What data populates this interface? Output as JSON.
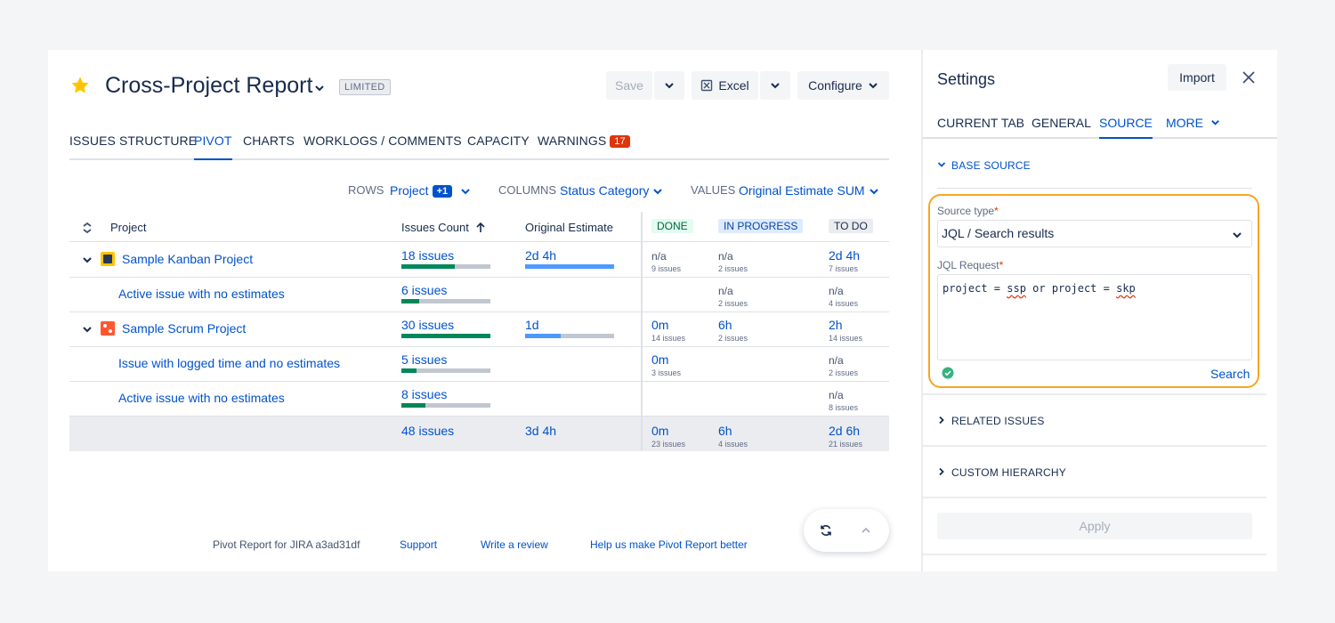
{
  "header": {
    "title": "Cross-Project Report",
    "badge": "LIMITED",
    "save_label": "Save",
    "excel_label": "Excel",
    "configure_label": "Configure"
  },
  "tabs": [
    {
      "label": "ISSUES STRUCTURE"
    },
    {
      "label": "PIVOT"
    },
    {
      "label": "CHARTS"
    },
    {
      "label": "WORKLOGS / COMMENTS"
    },
    {
      "label": "CAPACITY"
    },
    {
      "label": "WARNINGS",
      "badge": "17"
    }
  ],
  "config": {
    "rows_label": "ROWS",
    "rows_value": "Project",
    "rows_badge": "+1",
    "columns_label": "COLUMNS",
    "columns_value": "Status Category",
    "values_label": "VALUES",
    "values_value": "Original Estimate SUM"
  },
  "table": {
    "headers": {
      "project": "Project",
      "issues_count": "Issues Count",
      "original_estimate": "Original Estimate",
      "done": "DONE",
      "in_progress": "IN PROGRESS",
      "todo": "TO DO"
    },
    "rows": [
      {
        "name": "Sample Kanban Project",
        "count": "18 issues",
        "count_fill": 0.6,
        "estimate": "2d 4h",
        "est_fill": 1.0,
        "done": "n/a",
        "done_sub": "9 issues",
        "inprog": "n/a",
        "inprog_sub": "2 issues",
        "todo": "2d 4h",
        "todo_sub": "7 issues"
      },
      {
        "name": "Active issue with no estimates",
        "count": "6 issues",
        "count_fill": 0.2,
        "estimate": "",
        "est_fill": 0,
        "done": "",
        "done_sub": "",
        "inprog": "n/a",
        "inprog_sub": "2 issues",
        "todo": "n/a",
        "todo_sub": "4 issues"
      },
      {
        "name": "Sample Scrum Project",
        "count": "30 issues",
        "count_fill": 1.0,
        "estimate": "1d",
        "est_fill": 0.4,
        "done": "0m",
        "done_sub": "14 issues",
        "inprog": "6h",
        "inprog_sub": "2 issues",
        "todo": "2h",
        "todo_sub": "14 issues"
      },
      {
        "name": "Issue with logged time and no estimates",
        "count": "5 issues",
        "count_fill": 0.17,
        "estimate": "",
        "est_fill": 0,
        "done": "0m",
        "done_sub": "3 issues",
        "inprog": "",
        "inprog_sub": "",
        "todo": "n/a",
        "todo_sub": "2 issues"
      },
      {
        "name": "Active issue with no estimates",
        "count": "8 issues",
        "count_fill": 0.27,
        "estimate": "",
        "est_fill": 0,
        "done": "",
        "done_sub": "",
        "inprog": "",
        "inprog_sub": "",
        "todo": "n/a",
        "todo_sub": "8 issues"
      }
    ],
    "total": {
      "count": "48 issues",
      "estimate": "3d 4h",
      "done": "0m",
      "done_sub": "23 issues",
      "inprog": "6h",
      "inprog_sub": "4 issues",
      "todo": "2d 6h",
      "todo_sub": "21 issues"
    }
  },
  "footer": {
    "version": "Pivot Report for JIRA a3ad31df",
    "support": "Support",
    "review": "Write a review",
    "help": "Help us make Pivot Report better"
  },
  "settings": {
    "title": "Settings",
    "import_label": "Import",
    "tabs": [
      "CURRENT TAB",
      "GENERAL",
      "SOURCE",
      "MORE"
    ],
    "base_source": "BASE SOURCE",
    "source_type_label": "Source type",
    "source_type_value": "JQL / Search results",
    "jql_label": "JQL Request",
    "jql_parts": [
      "project = ",
      "ssp",
      " or project = ",
      "skp"
    ],
    "search_label": "Search",
    "related_issues": "RELATED ISSUES",
    "custom_hierarchy": "CUSTOM HIERARCHY",
    "apply_label": "Apply"
  },
  "colors": {
    "link": "#0052cc",
    "bar_green": "#00875a",
    "bar_blue": "#4c9aff",
    "bar_gray": "#c1c7d0",
    "warning": "#de350b",
    "highlight": "#f6a623",
    "done_bg": "#e3fcef",
    "done_fg": "#006644",
    "inprog_bg": "#deebff",
    "inprog_fg": "#0747a6",
    "todo_bg": "#ebecf0"
  }
}
